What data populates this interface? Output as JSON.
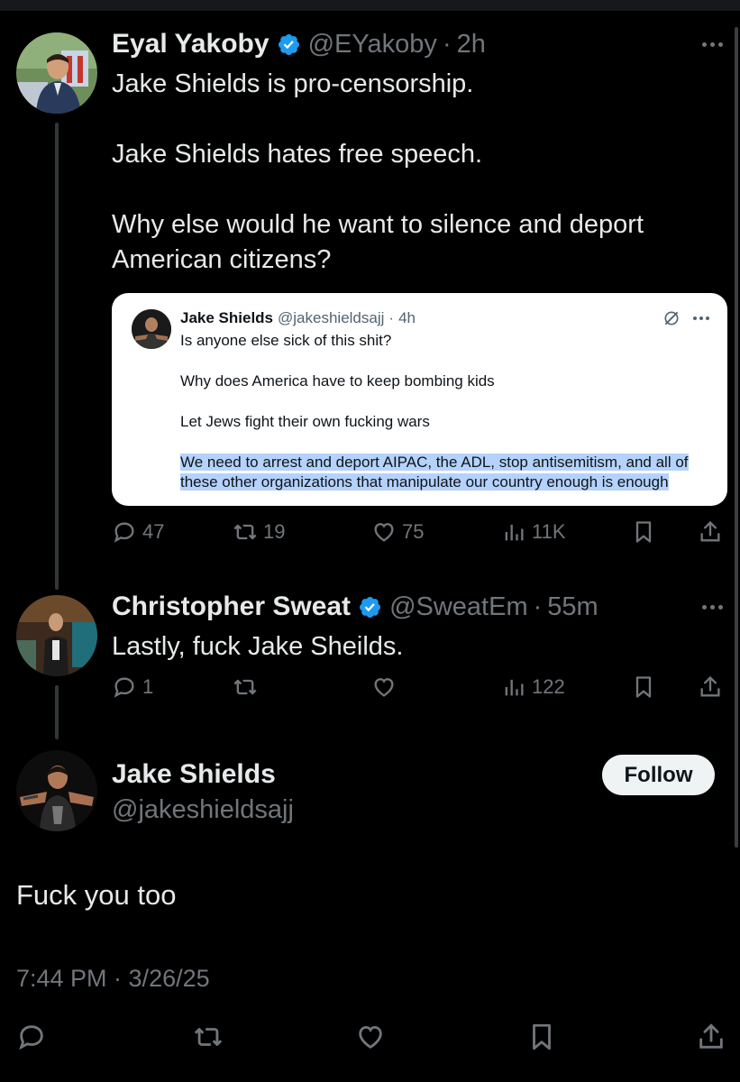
{
  "tweets": [
    {
      "name": "Eyal Yakoby",
      "handle": "@EYakoby",
      "separator": "·",
      "time": "2h",
      "verified": true,
      "paragraphs": [
        "Jake Shields is pro-censorship.",
        "Jake Shields hates free speech.",
        "Why else would he want to silence and deport American citizens?"
      ],
      "metrics": {
        "replies": "47",
        "reposts": "19",
        "likes": "75",
        "views": "11K"
      }
    },
    {
      "name": "Christopher Sweat",
      "handle": "@SweatEm",
      "separator": "·",
      "time": "55m",
      "verified": true,
      "text": "Lastly, fuck Jake Sheilds.",
      "metrics": {
        "replies": "1",
        "reposts": "",
        "likes": "",
        "views": "122"
      }
    }
  ],
  "quoted": {
    "name": "Jake Shields",
    "handle": "@jakeshieldsajj",
    "separator": "·",
    "time": "4h",
    "lines": [
      "Is anyone else sick of this shit?",
      "Why does America have to keep bombing kids",
      "Let Jews fight their own fucking wars",
      "We need to arrest and deport AIPAC, the ADL, stop antisemitism, and all of",
      "these other organizations that manipulate our country enough is enough"
    ]
  },
  "main_post": {
    "name": "Jake Shields",
    "handle": "@jakeshieldsajj",
    "follow_label": "Follow",
    "text": "Fuck you too",
    "timestamp": "7:44 PM · 3/26/25"
  },
  "colors": {
    "background": "#000000",
    "text": "#e7e9ea",
    "muted": "#71767b",
    "verified": "#1d9bf0",
    "highlight": "#b4d2fb"
  },
  "icons": {
    "reply": "reply-icon",
    "repost": "repost-icon",
    "like": "heart-icon",
    "views": "views-icon",
    "bookmark": "bookmark-icon",
    "share": "share-icon",
    "more": "more-icon",
    "verified": "verified-badge-icon"
  }
}
